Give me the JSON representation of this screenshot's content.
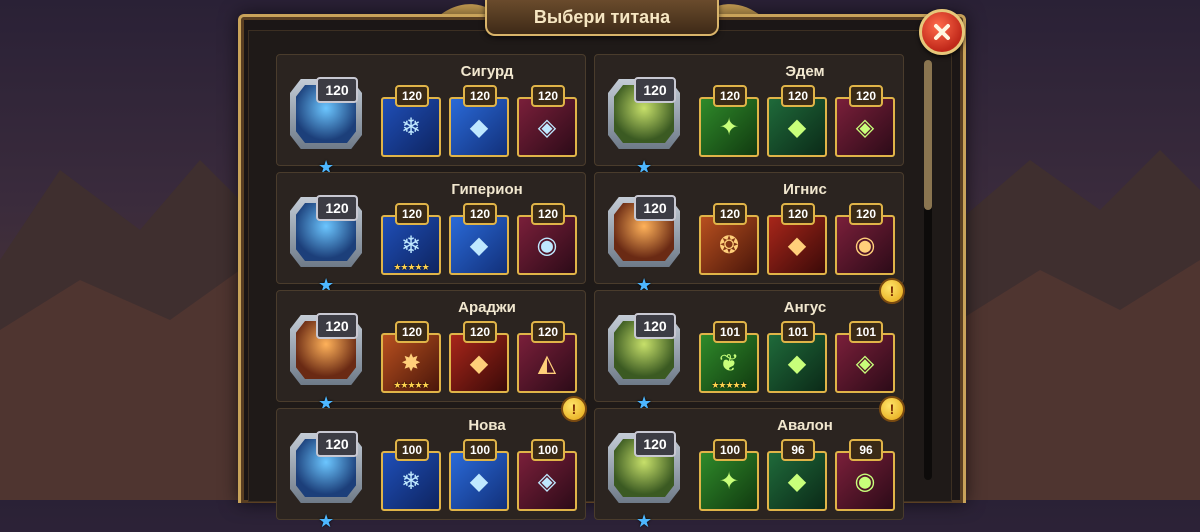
{
  "dialog": {
    "title": "Выбери титана",
    "close_icon": "close-icon"
  },
  "colors": {
    "frame_gold": "#c9a35a",
    "item_border": "#e0b448",
    "close_red": "#c0281a",
    "star_blue": "#4db7ff",
    "alert_yellow": "#e3a414"
  },
  "titans": [
    {
      "name": "Сигурд",
      "level": "120",
      "element": "water",
      "items": [
        {
          "level": "120",
          "glyph": "❄",
          "stars": ""
        },
        {
          "level": "120",
          "glyph": "◆",
          "stars": ""
        },
        {
          "level": "120",
          "glyph": "◈",
          "stars": ""
        }
      ],
      "alert": false
    },
    {
      "name": "Эдем",
      "level": "120",
      "element": "earth",
      "items": [
        {
          "level": "120",
          "glyph": "✦",
          "stars": ""
        },
        {
          "level": "120",
          "glyph": "◆",
          "stars": ""
        },
        {
          "level": "120",
          "glyph": "◈",
          "stars": ""
        }
      ],
      "alert": false
    },
    {
      "name": "Гиперион",
      "level": "120",
      "element": "water",
      "items": [
        {
          "level": "120",
          "glyph": "❄",
          "stars": "★★★★★"
        },
        {
          "level": "120",
          "glyph": "◆",
          "stars": ""
        },
        {
          "level": "120",
          "glyph": "◉",
          "stars": ""
        }
      ],
      "alert": false
    },
    {
      "name": "Игнис",
      "level": "120",
      "element": "fire",
      "items": [
        {
          "level": "120",
          "glyph": "❂",
          "stars": ""
        },
        {
          "level": "120",
          "glyph": "◆",
          "stars": ""
        },
        {
          "level": "120",
          "glyph": "◉",
          "stars": ""
        }
      ],
      "alert": false
    },
    {
      "name": "Араджи",
      "level": "120",
      "element": "fire",
      "items": [
        {
          "level": "120",
          "glyph": "✸",
          "stars": "★★★★★"
        },
        {
          "level": "120",
          "glyph": "◆",
          "stars": ""
        },
        {
          "level": "120",
          "glyph": "◭",
          "stars": ""
        }
      ],
      "alert": false
    },
    {
      "name": "Ангус",
      "level": "120",
      "element": "earth",
      "items": [
        {
          "level": "101",
          "glyph": "❦",
          "stars": "★★★★★"
        },
        {
          "level": "101",
          "glyph": "◆",
          "stars": ""
        },
        {
          "level": "101",
          "glyph": "◈",
          "stars": ""
        }
      ],
      "alert": true
    },
    {
      "name": "Нова",
      "level": "120",
      "element": "water",
      "items": [
        {
          "level": "100",
          "glyph": "❄",
          "stars": ""
        },
        {
          "level": "100",
          "glyph": "◆",
          "stars": ""
        },
        {
          "level": "100",
          "glyph": "◈",
          "stars": ""
        }
      ],
      "alert": true
    },
    {
      "name": "Авалон",
      "level": "120",
      "element": "earth",
      "items": [
        {
          "level": "100",
          "glyph": "✦",
          "stars": ""
        },
        {
          "level": "96",
          "glyph": "◆",
          "stars": ""
        },
        {
          "level": "96",
          "glyph": "◉",
          "stars": ""
        }
      ],
      "alert": true
    }
  ],
  "alert_symbol": "!",
  "titan_star": "★"
}
